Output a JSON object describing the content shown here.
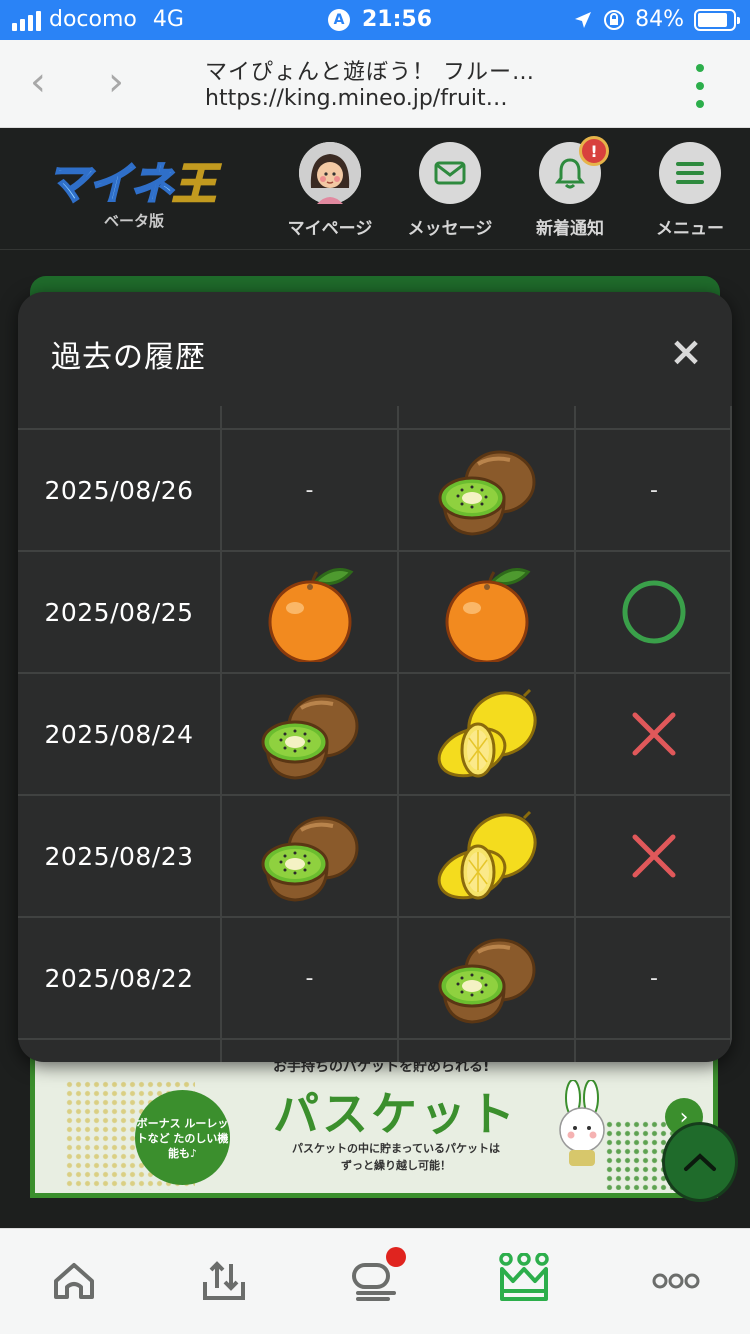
{
  "status": {
    "carrier": "docomo",
    "network": "4G",
    "time": "21:56",
    "battery": "84%",
    "battery_level": 0.84
  },
  "browser": {
    "title": "マイぴょんと遊ぼう！ フルー…",
    "url": "https://king.mineo.jp/fruit…"
  },
  "header": {
    "logo_text_a": "マイネ",
    "logo_text_b": "王",
    "logo_sub": "ベータ版",
    "nav": [
      {
        "label": "マイページ",
        "icon": "avatar-icon"
      },
      {
        "label": "メッセージ",
        "icon": "mail-icon"
      },
      {
        "label": "新着通知",
        "icon": "bell-icon",
        "badge": "!"
      },
      {
        "label": "メニュー",
        "icon": "menu-icon"
      }
    ]
  },
  "modal": {
    "title": "過去の履歴",
    "close": "×",
    "rows": [
      {
        "date": "2025/08/26",
        "pick": "-",
        "result": "kiwi",
        "mark": "-"
      },
      {
        "date": "2025/08/25",
        "pick": "orange",
        "result": "orange",
        "mark": "circle"
      },
      {
        "date": "2025/08/24",
        "pick": "kiwi",
        "result": "lemon",
        "mark": "cross"
      },
      {
        "date": "2025/08/23",
        "pick": "kiwi",
        "result": "lemon",
        "mark": "cross"
      },
      {
        "date": "2025/08/22",
        "pick": "-",
        "result": "kiwi",
        "mark": "-"
      }
    ]
  },
  "banner": {
    "top_text": "お手持ちのパケットを貯められる!",
    "circle_text": "ボーナス ルーレットなど たのしい機能も♪",
    "title": "パスケット",
    "subtitle_1": "パスケットの中に貯まっているパケットは",
    "subtitle_2": "ずっと繰り越し可能！",
    "arrow": "›"
  },
  "colors": {
    "accent_green": "#3b8f2d",
    "circle_green": "#3aa04a",
    "cross_red": "#e0585a",
    "status_blue": "#2a83f6"
  }
}
